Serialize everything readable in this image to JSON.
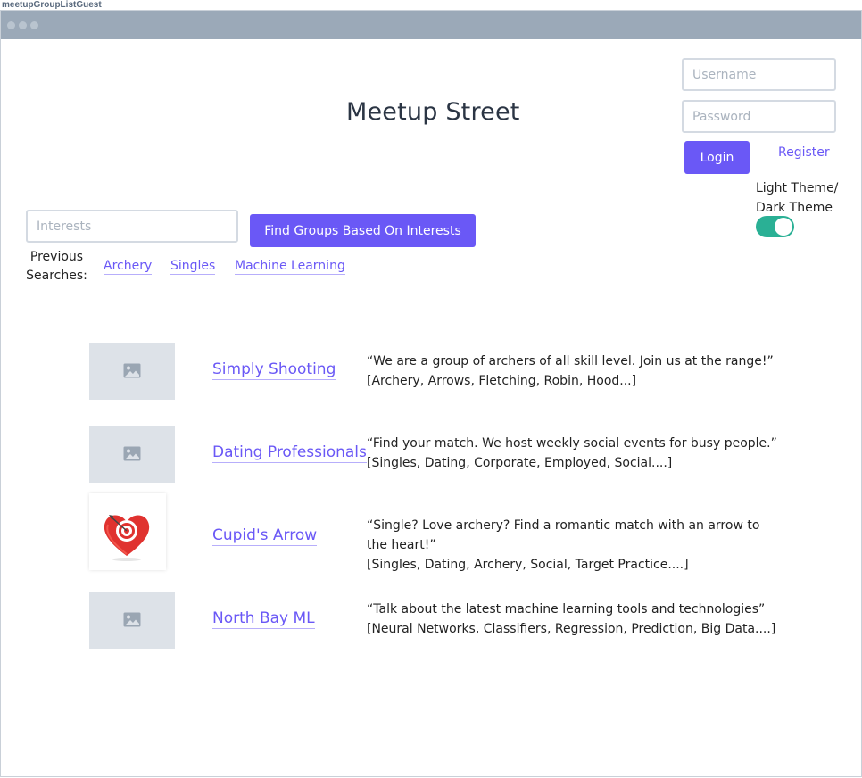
{
  "frame_label": "meetupGroupListGuest",
  "header": {
    "title": "Meetup Street",
    "username_placeholder": "Username",
    "password_placeholder": "Password",
    "login_label": "Login",
    "register_label": "Register",
    "theme_label_line1": "Light Theme/",
    "theme_label_line2": "Dark Theme",
    "theme_toggle_on": true
  },
  "search": {
    "placeholder": "Interests",
    "button_label": "Find Groups Based On Interests",
    "previous_label_line1": "Previous",
    "previous_label_line2": "Searches:",
    "previous": [
      "Archery",
      "Singles",
      "Machine Learning"
    ]
  },
  "groups": [
    {
      "name": "Simply Shooting",
      "image": "image-placeholder-icon",
      "description": "“We are a group of archers of all skill level. Join us at the range!”",
      "tags": "[Archery, Arrows, Fletching, Robin, Hood...]"
    },
    {
      "name": "Dating Professionals",
      "image": "image-placeholder-icon",
      "description": "“Find your match. We host weekly social events for busy people.”",
      "tags": "[Singles, Dating, Corporate, Employed, Social....]"
    },
    {
      "name": "Cupid's Arrow",
      "image": "heart-target-logo",
      "description_line1": "“Single? Love archery? Find a romantic match with an arrow to",
      "description_line2": "the heart!”",
      "tags": "[Singles, Dating, Archery,  Social, Target Practice....]"
    },
    {
      "name": "North Bay ML",
      "image": "image-placeholder-icon",
      "description": "“Talk about the latest machine learning tools and technologies”",
      "tags": "[Neural Networks, Classifiers, Regression, Prediction, Big Data....]"
    }
  ],
  "colors": {
    "accent": "#6a58f6",
    "toggle": "#2ab095",
    "titlebar": "#9ba9b8",
    "placeholder_bg": "#dde2e8"
  }
}
